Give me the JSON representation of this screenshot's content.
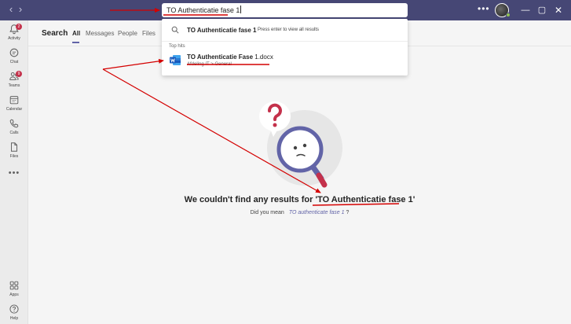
{
  "search": {
    "query": "TO Authenticatie fase 1"
  },
  "appbar": {
    "items": [
      {
        "label": "Activity",
        "badge": "2"
      },
      {
        "label": "Chat"
      },
      {
        "label": "Teams",
        "badge": "9"
      },
      {
        "label": "Calendar"
      },
      {
        "label": "Calls"
      },
      {
        "label": "Files"
      }
    ],
    "more": "•••",
    "bottom": [
      {
        "label": "Apps"
      },
      {
        "label": "Help"
      }
    ]
  },
  "main": {
    "heading": "Search",
    "tabs": [
      "All",
      "Messages",
      "People",
      "Files"
    ]
  },
  "dropdown": {
    "suggestion": {
      "query": "TO Authenticatie fase 1",
      "hint": "Press enter to view all results"
    },
    "section_label": "Top hits",
    "top_hit": {
      "name_bold": "TO Authenticatie Fase",
      "name_rest": " 1.docx",
      "path_team": "Afdeling IT",
      "path_sep": ">",
      "path_channel": "General"
    }
  },
  "empty_state": {
    "prefix": "We couldn't find any results for '",
    "query": "TO Authenticatie fase 1",
    "suffix": "'",
    "did_you_mean_label": "Did you mean",
    "suggestion": "TO authenticate fase 1",
    "suggestion_suffix": " ?"
  },
  "colors": {
    "titlebar": "#464775",
    "accent": "#6264a7",
    "badge": "#c4314b",
    "annotation": "#d40000"
  }
}
